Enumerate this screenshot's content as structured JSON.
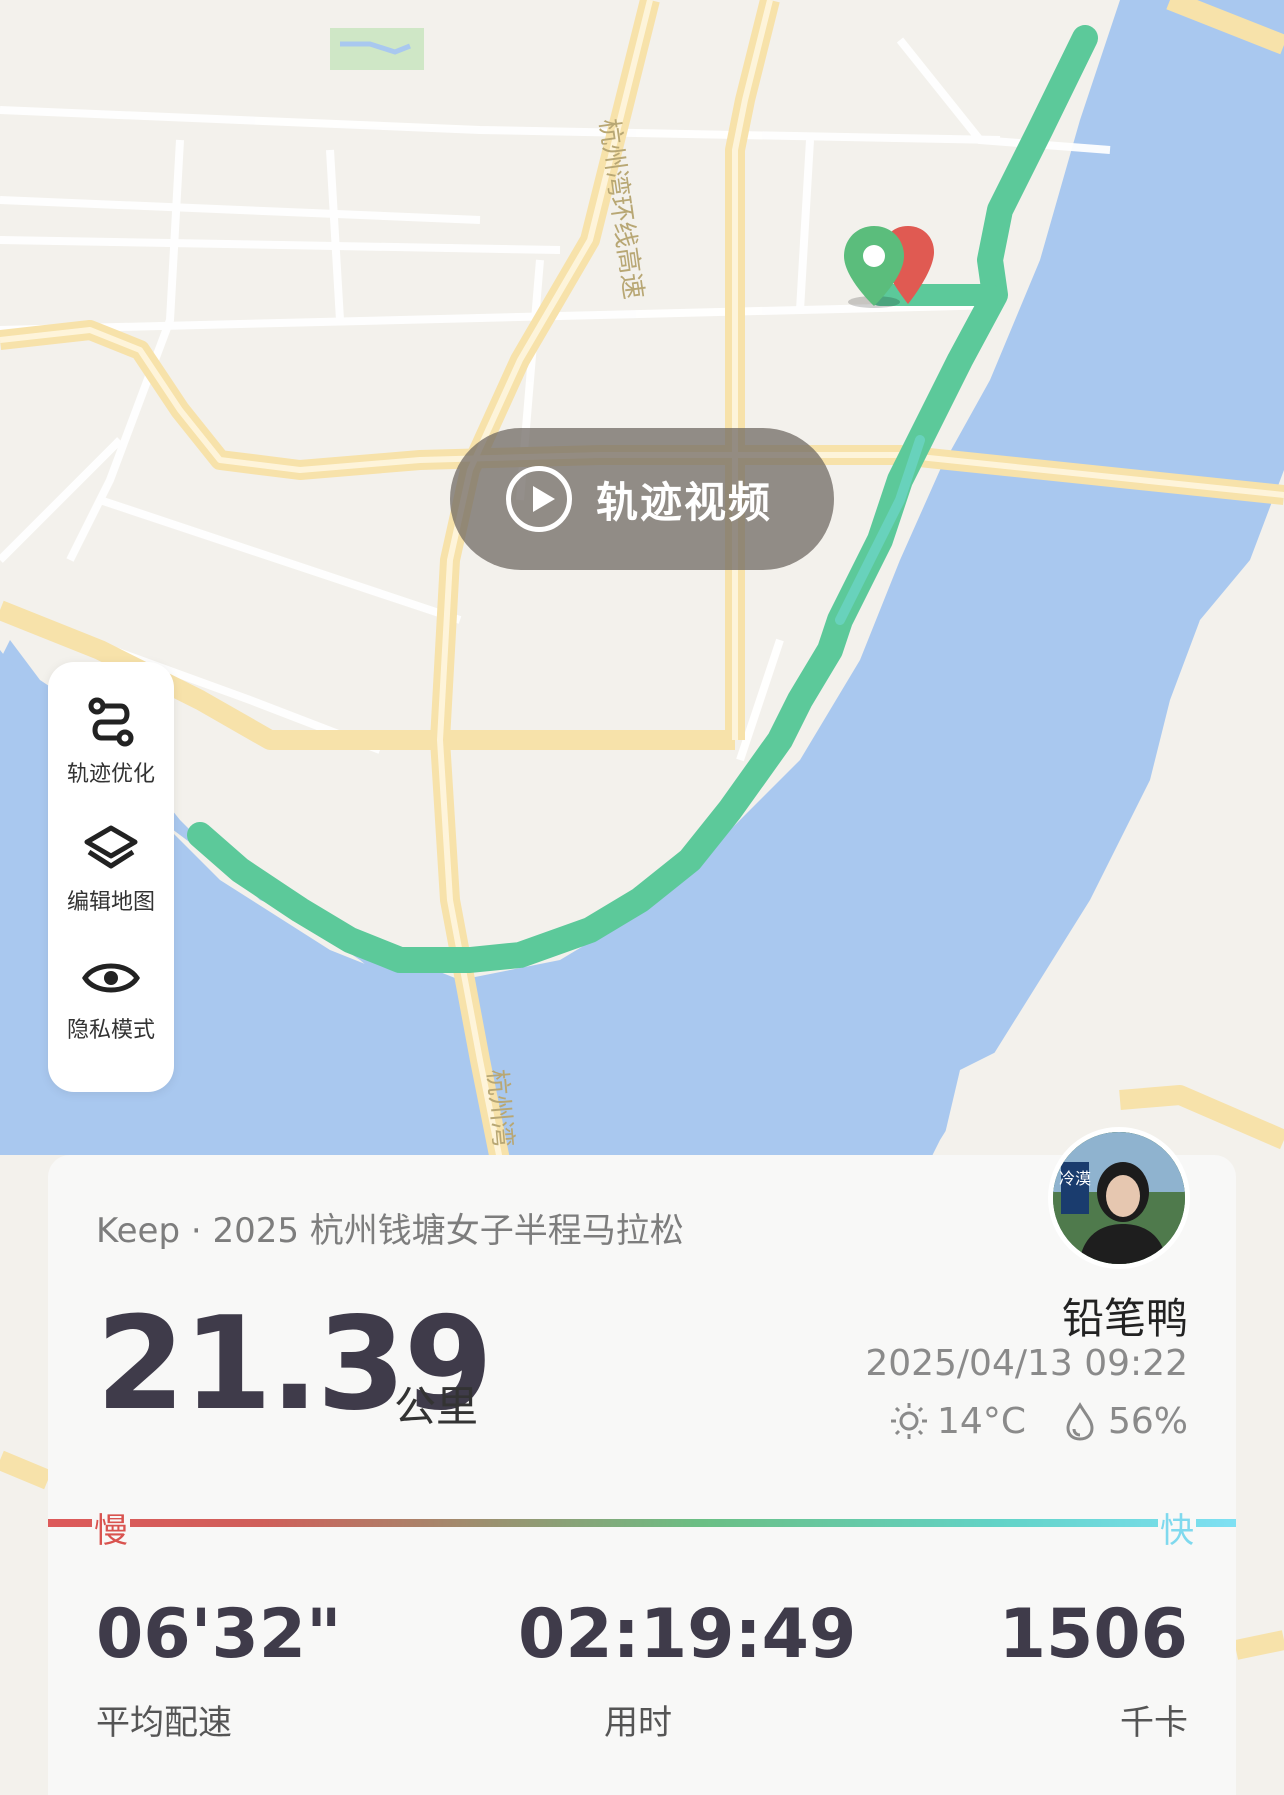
{
  "map": {
    "road_labels": [
      "杭州湾环线高速",
      "杭州湾"
    ],
    "track_video_label": "轨迹视频"
  },
  "tools": [
    {
      "label": "轨迹优化",
      "icon": "route-optimize-icon"
    },
    {
      "label": "编辑地图",
      "icon": "layers-icon"
    },
    {
      "label": "隐私模式",
      "icon": "eye-icon"
    }
  ],
  "summary": {
    "event": "Keep · 2025 杭州钱塘女子半程马拉松",
    "distance": "21.39",
    "distance_unit": "公里",
    "user_name": "铅笔鸭",
    "avatar_badge": "冷漠",
    "datetime": "2025/04/13 09:22",
    "temperature": "14°C",
    "humidity": "56%",
    "slow_label": "慢",
    "fast_label": "快",
    "stats": [
      {
        "value": "06'32\"",
        "label": "平均配速"
      },
      {
        "value": "02:19:49",
        "label": "用时"
      },
      {
        "value": "1506",
        "label": "千卡"
      }
    ]
  },
  "colors": {
    "track": "#5cc99a",
    "water": "#a9c8ef",
    "road": "#f8e6b4",
    "start_marker": "#5bbd7c",
    "end_marker": "#e05a52"
  }
}
